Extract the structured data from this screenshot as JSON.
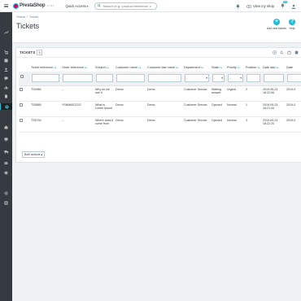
{
  "app": {
    "logo_text": "PrestaShop",
    "version": "1.7.6.1",
    "quick_access": "Quick Access",
    "search_placeholder": "Search (e.g.: product reference, custome",
    "view_shop": "View my shop",
    "notif_count": "12"
  },
  "breadcrumb": {
    "parent": "Orders",
    "current": "Tickets"
  },
  "page": {
    "title": "Tickets",
    "add_label": "Add new tickets",
    "help_label": "Help"
  },
  "panel": {
    "title": "TICKETS",
    "count": "3",
    "bulk_label": "Bulk actions"
  },
  "columns": [
    "",
    "Ticket reference",
    "Order reference",
    "Subject",
    "Customer name",
    "Customer last name",
    "Department",
    "State",
    "Priority",
    "Position",
    "Date add",
    "Date"
  ],
  "filters": {
    "select_placeholder": "-",
    "chevron": "▾"
  },
  "rows": [
    {
      "ticket": "TS4980",
      "order": "--",
      "subject": "Why do we use it",
      "customer": "Demo",
      "last": "Demo",
      "department": "Customer Service",
      "state": "Waiting answer",
      "priority": "Urgent",
      "position": "2",
      "date_add": "2019-09-23 18:22:06",
      "date": "2019-0"
    },
    {
      "ticket": "TS5889",
      "order": "YSNMMZCGG",
      "subject": "What is Lorem Ipsum",
      "customer": "Demo",
      "last": "Demo",
      "department": "Customer Service",
      "state": "Opened",
      "priority": "Normal",
      "position": "1",
      "date_add": "2019-09-23 18:21:44",
      "date": "2019-0"
    },
    {
      "ticket": "TS5754",
      "order": "--",
      "subject": "Where does it come from",
      "customer": "Demo",
      "last": "Demo",
      "department": "Customer Service",
      "state": "Opened",
      "priority": "Normal",
      "position": "3",
      "date_add": "2019-09-23 18:22:20",
      "date": "2019-0"
    }
  ],
  "colors": {
    "accent": "#25b9d7",
    "sidebar": "#363a41",
    "brand": "#df0067"
  }
}
